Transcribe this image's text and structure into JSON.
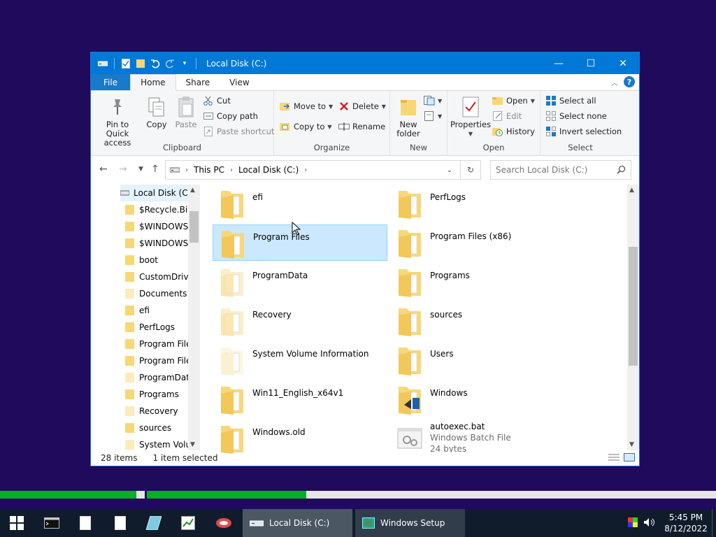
{
  "window": {
    "title": "Local Disk (C:)"
  },
  "titlebar": {
    "minimize": "—",
    "maximize": "☐",
    "close": "✕"
  },
  "tabs": [
    "File",
    "Home",
    "Share",
    "View"
  ],
  "ribbon": {
    "clipboard": {
      "pin": "Pin to Quick access",
      "copy": "Copy",
      "paste": "Paste",
      "cut": "Cut",
      "copy_path": "Copy path",
      "paste_shortcut": "Paste shortcut",
      "label": "Clipboard"
    },
    "organize": {
      "move_to": "Move to",
      "copy_to": "Copy to",
      "delete": "Delete",
      "rename": "Rename",
      "label": "Organize"
    },
    "new": {
      "new_folder": "New folder",
      "label": "New"
    },
    "open": {
      "properties": "Properties",
      "open": "Open",
      "edit": "Edit",
      "history": "History",
      "label": "Open"
    },
    "select": {
      "select_all": "Select all",
      "select_none": "Select none",
      "invert": "Invert selection",
      "label": "Select"
    }
  },
  "address": {
    "breadcrumbs": [
      "This PC",
      "Local Disk (C:)"
    ],
    "search_placeholder": "Search Local Disk (C:)"
  },
  "navpane": {
    "root": "Local Disk (C:)",
    "items": [
      {
        "label": "$Recycle.Bin",
        "faded": false
      },
      {
        "label": "$WINDOWS.~",
        "faded": false
      },
      {
        "label": "$WINDOWS.~",
        "faded": false
      },
      {
        "label": "boot",
        "faded": false
      },
      {
        "label": "CustomDrive",
        "faded": false
      },
      {
        "label": "Documents a",
        "faded": true
      },
      {
        "label": "efi",
        "faded": false
      },
      {
        "label": "PerfLogs",
        "faded": false
      },
      {
        "label": "Program Files",
        "faded": false
      },
      {
        "label": "Program Files",
        "faded": false
      },
      {
        "label": "ProgramData",
        "faded": true
      },
      {
        "label": "Programs",
        "faded": false
      },
      {
        "label": "Recovery",
        "faded": true
      },
      {
        "label": "sources",
        "faded": false
      },
      {
        "label": "System Volun",
        "faded": true
      }
    ]
  },
  "files": [
    {
      "name": "efi",
      "type": "folder"
    },
    {
      "name": "PerfLogs",
      "type": "folder"
    },
    {
      "name": "Program Files",
      "type": "folder",
      "selected": true
    },
    {
      "name": "Program Files (x86)",
      "type": "folder"
    },
    {
      "name": "ProgramData",
      "type": "folder-hidden"
    },
    {
      "name": "Programs",
      "type": "folder"
    },
    {
      "name": "Recovery",
      "type": "folder-hidden"
    },
    {
      "name": "sources",
      "type": "folder"
    },
    {
      "name": "System Volume Information",
      "type": "folder-system"
    },
    {
      "name": "Users",
      "type": "folder"
    },
    {
      "name": "Win11_English_x64v1",
      "type": "folder"
    },
    {
      "name": "Windows",
      "type": "folder-windows"
    },
    {
      "name": "Windows.old",
      "type": "folder"
    },
    {
      "name": "autoexec.bat",
      "type": "batch",
      "subtitle": "Windows Batch File",
      "size": "24 bytes"
    }
  ],
  "status": {
    "count": "28 items",
    "selection": "1 item selected"
  },
  "progress": [
    0.94,
    0.28
  ],
  "taskbar": {
    "tasks": [
      {
        "label": "Local Disk (C:)",
        "active": true
      },
      {
        "label": "Windows Setup",
        "active": false
      }
    ],
    "time": "5:45 PM",
    "date": "8/12/2022"
  },
  "colors": {
    "accent": "#0078d7",
    "desktop": "#1f0a5c",
    "folder": "#f8d775",
    "selection": "#cce8ff",
    "progress": "#06b025"
  }
}
